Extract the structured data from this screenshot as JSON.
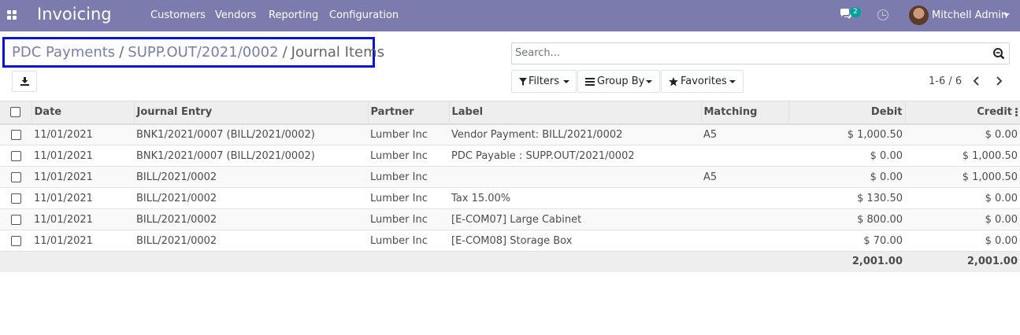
{
  "navbar": {
    "app_title": "Invoicing",
    "menu": [
      "Customers",
      "Vendors",
      "Reporting",
      "Configuration"
    ],
    "messages_badge": "2",
    "user_name": "Mitchell Admin",
    "icons": [
      "apps-icon",
      "chat-icon",
      "clock-icon",
      "avatar"
    ]
  },
  "breadcrumb": {
    "items": [
      "PDC Payments",
      "SUPP.OUT/2021/0002"
    ],
    "current": "Journal Items",
    "separator": "/"
  },
  "toolbar": {
    "download_icon": "download-icon"
  },
  "search": {
    "placeholder": "Search...",
    "value": ""
  },
  "filters": {
    "filters_label": "Filters",
    "group_by_label": "Group By",
    "favorites_label": "Favorites"
  },
  "pager": {
    "value": "1-6 / 6"
  },
  "table": {
    "columns": [
      "Date",
      "Journal Entry",
      "Partner",
      "Label",
      "Matching",
      "Debit",
      "Credit"
    ],
    "rows": [
      [
        "11/01/2021",
        "BNK1/2021/0007 (BILL/2021/0002)",
        "Lumber Inc",
        "Vendor Payment: BILL/2021/0002",
        "A5",
        "$ 1,000.50",
        "$ 0.00"
      ],
      [
        "11/01/2021",
        "BNK1/2021/0007 (BILL/2021/0002)",
        "Lumber Inc",
        "PDC Payable : SUPP.OUT/2021/0002",
        "",
        "$ 0.00",
        "$ 1,000.50"
      ],
      [
        "11/01/2021",
        "BILL/2021/0002",
        "Lumber Inc",
        "",
        "A5",
        "$ 0.00",
        "$ 1,000.50"
      ],
      [
        "11/01/2021",
        "BILL/2021/0002",
        "Lumber Inc",
        "Tax 15.00%",
        "",
        "$ 130.50",
        "$ 0.00"
      ],
      [
        "11/01/2021",
        "BILL/2021/0002",
        "Lumber Inc",
        "[E-COM07] Large Cabinet",
        "",
        "$ 800.00",
        "$ 0.00"
      ],
      [
        "11/01/2021",
        "BILL/2021/0002",
        "Lumber Inc",
        "[E-COM08] Storage Box",
        "",
        "$ 70.00",
        "$ 0.00"
      ]
    ],
    "totals": {
      "debit": "2,001.00",
      "credit": "2,001.00"
    }
  },
  "colors": {
    "navbar": "#7c7bad",
    "highlight_border": "#0b13d9",
    "badge": "#00a09d"
  }
}
